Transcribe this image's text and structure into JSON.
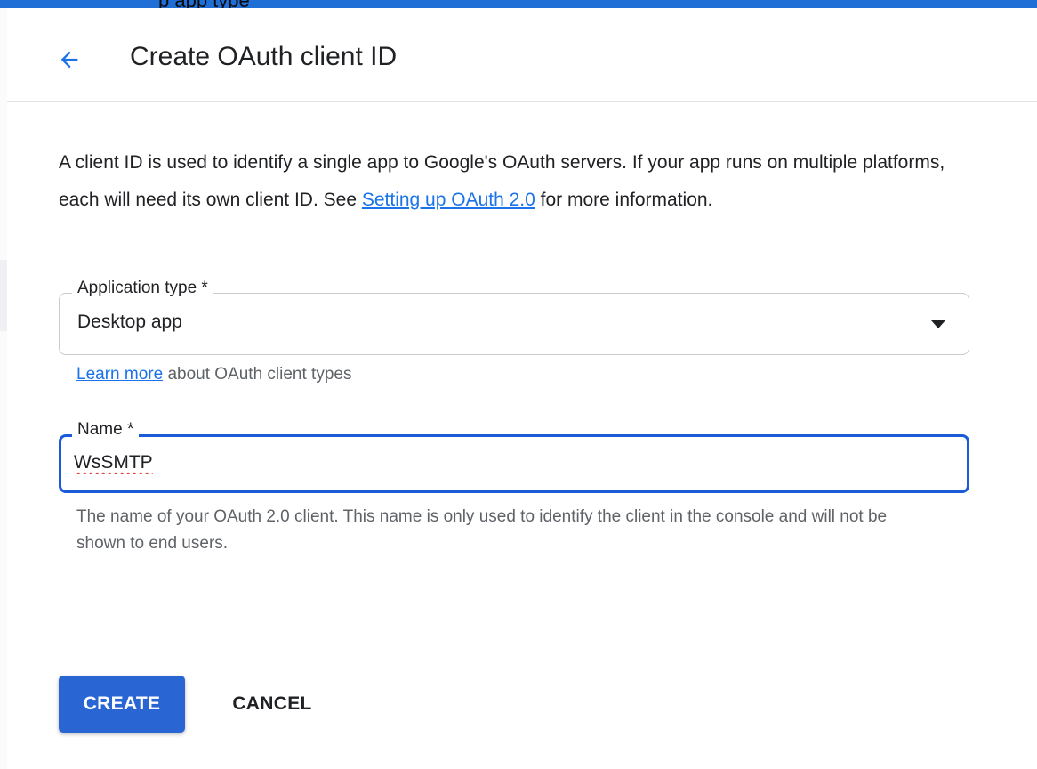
{
  "top_bar": {
    "partial_text": "p app type"
  },
  "header": {
    "back_icon": "arrow-back-icon",
    "title": "Create OAuth client ID"
  },
  "description": {
    "text_before_link": "A client ID is used to identify a single app to Google's OAuth servers. If your app runs on multiple platforms, each will need its own client ID. See ",
    "link_text": "Setting up OAuth 2.0",
    "text_after_link": " for more information."
  },
  "application_type": {
    "label": "Application type *",
    "value": "Desktop app",
    "caret_icon": "arrow-drop-down-icon",
    "learn_more_link": "Learn more",
    "learn_more_suffix": " about OAuth client types"
  },
  "name_field": {
    "label": "Name *",
    "value": "WsSMTP",
    "helper_text": "The name of your OAuth 2.0 client. This name is only used to identify the client in the console and will not be shown to end users."
  },
  "actions": {
    "create_label": "CREATE",
    "cancel_label": "CANCEL"
  },
  "colors": {
    "top_bar": "#1f6fd6",
    "link": "#1a73e8",
    "focus_border": "#1a5bd8",
    "primary_button": "#2a66d3"
  }
}
